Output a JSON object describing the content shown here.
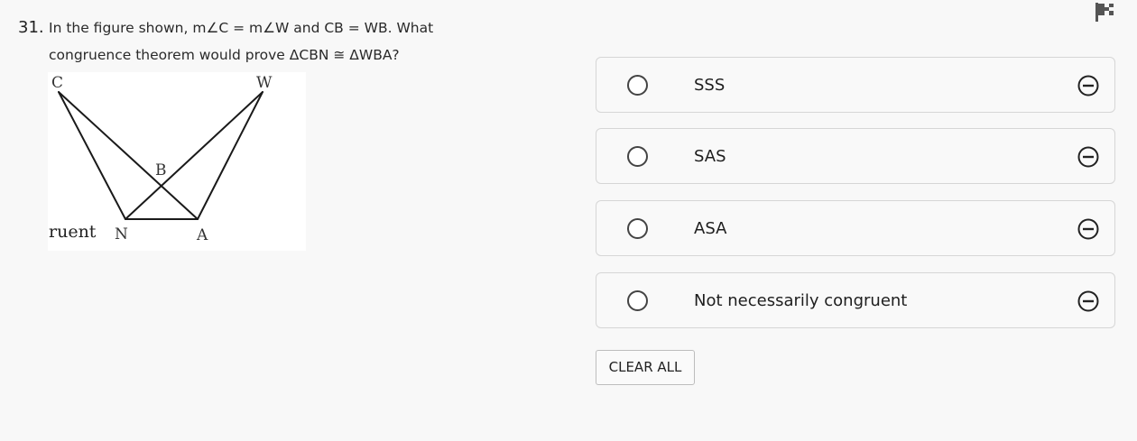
{
  "header": {
    "flag_icon": "flag-icon"
  },
  "question": {
    "number": "31.",
    "line1": "In the figure shown, m∠C = m∠W and CB = WB.  What",
    "line2": "congruence theorem would prove ΔCBN ≅ ΔWBA?"
  },
  "figure": {
    "vertex_c": "C",
    "vertex_w": "W",
    "vertex_b": "B",
    "vertex_n": "N",
    "vertex_a": "A",
    "overflow_text": "ruent"
  },
  "options": [
    {
      "label": "SSS"
    },
    {
      "label": "SAS"
    },
    {
      "label": "ASA"
    },
    {
      "label": "Not necessarily congruent"
    }
  ],
  "actions": {
    "clear_all": "CLEAR ALL"
  },
  "icons": {
    "radio": "radio-circle",
    "eliminate": "eliminate-minus-circle-icon"
  },
  "colors": {
    "background": "#f8f8f8",
    "option_border": "#d6d6d6",
    "text": "#222222"
  }
}
